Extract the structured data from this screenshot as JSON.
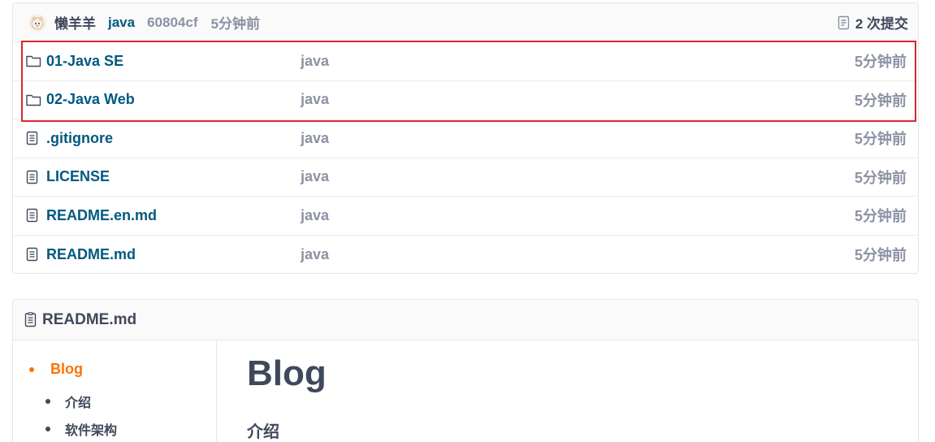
{
  "commit": {
    "author": "懒羊羊",
    "message": "java",
    "sha": "60804cf",
    "time": "5分钟前",
    "commit_count": "2 次提交"
  },
  "files": [
    {
      "name": "01-Java SE",
      "type": "folder",
      "message": "java",
      "time": "5分钟前"
    },
    {
      "name": "02-Java Web",
      "type": "folder",
      "message": "java",
      "time": "5分钟前"
    },
    {
      "name": ".gitignore",
      "type": "file",
      "message": "java",
      "time": "5分钟前"
    },
    {
      "name": "LICENSE",
      "type": "file",
      "message": "java",
      "time": "5分钟前"
    },
    {
      "name": "README.en.md",
      "type": "file",
      "message": "java",
      "time": "5分钟前"
    },
    {
      "name": "README.md",
      "type": "file",
      "message": "java",
      "time": "5分钟前"
    }
  ],
  "readme": {
    "title": "README.md",
    "toc": [
      {
        "label": "Blog",
        "level": 1
      },
      {
        "label": "介绍",
        "level": 2
      },
      {
        "label": "软件架构",
        "level": 2
      }
    ],
    "heading": "Blog",
    "subheading": "介绍"
  },
  "colors": {
    "link": "#005980",
    "muted": "#8c92a4",
    "text": "#40485b",
    "accent": "#fe7300",
    "highlight": "#d9272e"
  }
}
